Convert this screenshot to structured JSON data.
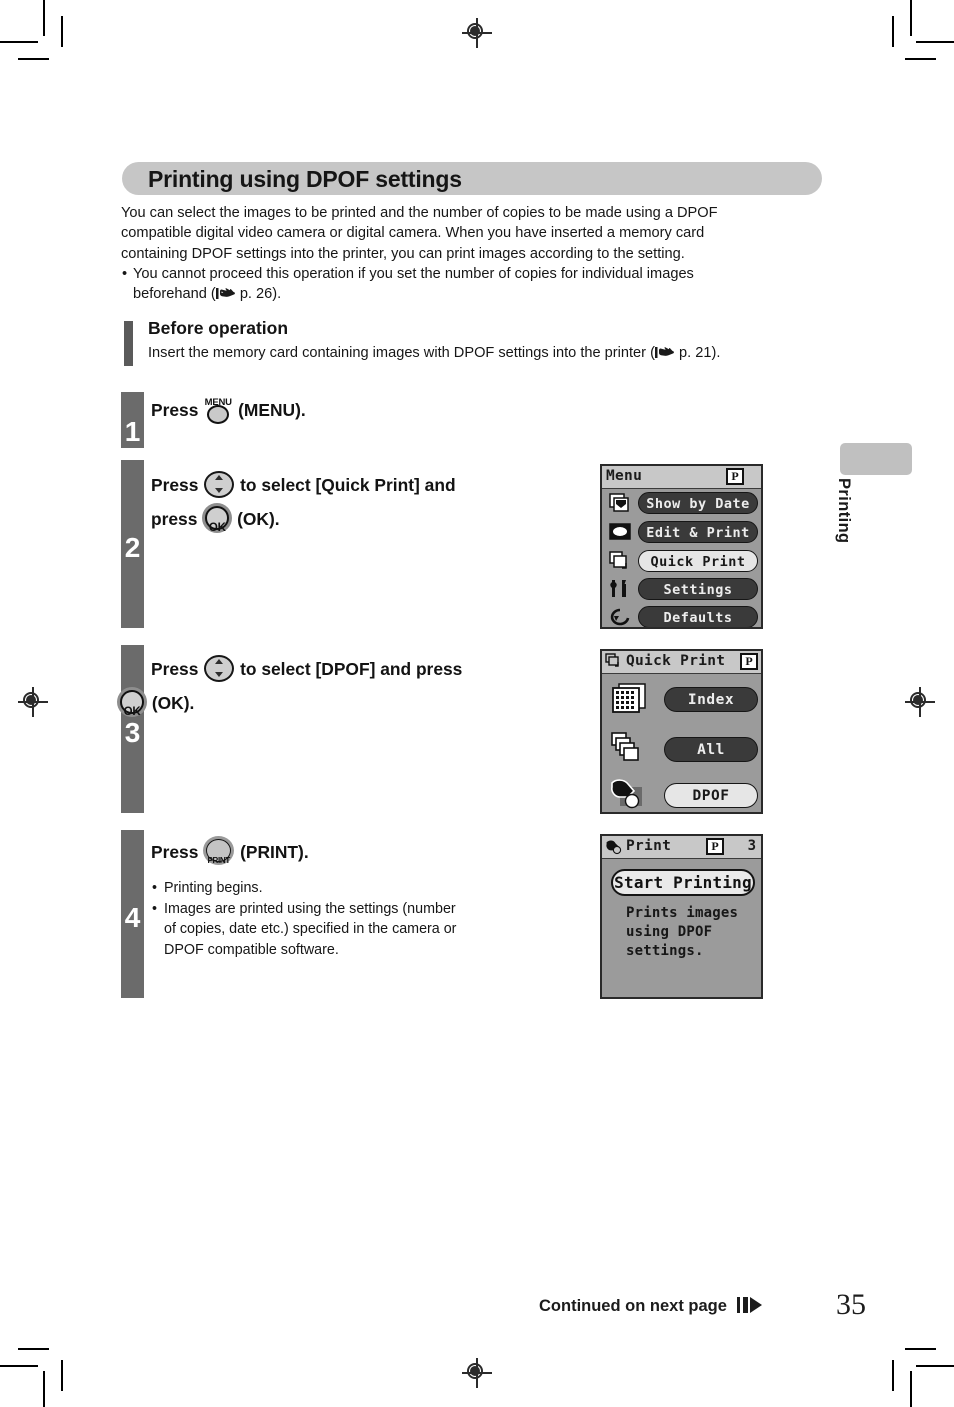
{
  "section": {
    "title": "Printing using DPOF settings"
  },
  "intro": {
    "line1": "You can select the images to be printed and the number of copies to be made using a DPOF",
    "line2": "compatible digital video camera or digital camera. When you have inserted a memory card",
    "line3": "containing DPOF settings into the printer, you can print images according to the setting.",
    "bullet_dot": "•",
    "bullet1_a": "You cannot proceed this operation if you set the number of copies for individual images",
    "bullet1_b_pre": "beforehand (",
    "bullet1_b_post": " p. 26).",
    "hand_icon": "pointing-hand-icon"
  },
  "before_operation": {
    "heading": "Before operation",
    "text_pre": "Insert the memory card containing images with DPOF settings into the printer (",
    "text_post": " p. 21)."
  },
  "steps": [
    {
      "number": "1",
      "head_pre": "Press",
      "button_icon": "menu-button-icon",
      "button_label": "MENU",
      "head_post": "(MENU)."
    },
    {
      "number": "2",
      "line1_pre": "Press",
      "line1_icon": "up-down-button-icon",
      "line1_post": "to select [Quick Print] and",
      "line2_pre": "press",
      "line2_icon": "ok-button-icon",
      "line2_icon_label": "OK",
      "line2_post": "(OK)."
    },
    {
      "number": "3",
      "line1_pre": "Press",
      "line1_icon": "up-down-button-icon",
      "line1_post": "to select [DPOF] and press",
      "line2_icon": "ok-button-icon",
      "line2_icon_label": "OK",
      "line2_post": "(OK)."
    },
    {
      "number": "4",
      "head_pre": "Press",
      "button_icon": "print-button-icon",
      "button_label": "PRINT",
      "head_post": "(PRINT).",
      "notes": [
        "Printing begins.",
        "Images are printed using the settings (number",
        "of copies, date etc.) specified in the camera or",
        "DPOF compatible software."
      ]
    }
  ],
  "lcd_menu": {
    "title": "Menu",
    "p_mark": "P",
    "items": [
      {
        "label": "Show by Date",
        "icon": "stacked-photos-date-icon",
        "selected": false
      },
      {
        "label": "Edit & Print",
        "icon": "single-photo-icon",
        "selected": false
      },
      {
        "label": "Quick Print",
        "icon": "stacked-copies-icon",
        "selected": true
      },
      {
        "label": "Settings",
        "icon": "tools-wrench-icon",
        "selected": false
      },
      {
        "label": "Defaults",
        "icon": "reset-arrow-icon",
        "selected": false
      }
    ]
  },
  "lcd_quick_print": {
    "title": "Quick Print",
    "title_icon": "stacked-copies-icon",
    "p_mark": "P",
    "items": [
      {
        "label": "Index",
        "icon": "index-grid-icon",
        "selected": false
      },
      {
        "label": "All",
        "icon": "all-photos-icon",
        "selected": false
      },
      {
        "label": "DPOF",
        "icon": "dpof-camera-icon",
        "selected": true
      }
    ]
  },
  "lcd_print": {
    "title": "Print",
    "title_icon": "dpof-camera-icon",
    "p_mark": "P",
    "copies": "3",
    "action": "Start Printing",
    "description_lines": [
      "Prints images",
      "using DPOF",
      "settings."
    ]
  },
  "side_tab": {
    "label": "Printing"
  },
  "footer": {
    "continued": "Continued on next page",
    "arrow_icon": "continued-arrow-icon",
    "page_number": "35"
  },
  "colors": {
    "banner_gray": "#c6c6c6",
    "step_bar_gray": "#6b6b6b",
    "lcd_bg": "#9b9b9b",
    "lcd_title_bg": "#c8c8c8",
    "pill_dark": "#3a3a3a",
    "pill_light": "#e6e6e6",
    "side_tab": "#c0c0c0"
  }
}
